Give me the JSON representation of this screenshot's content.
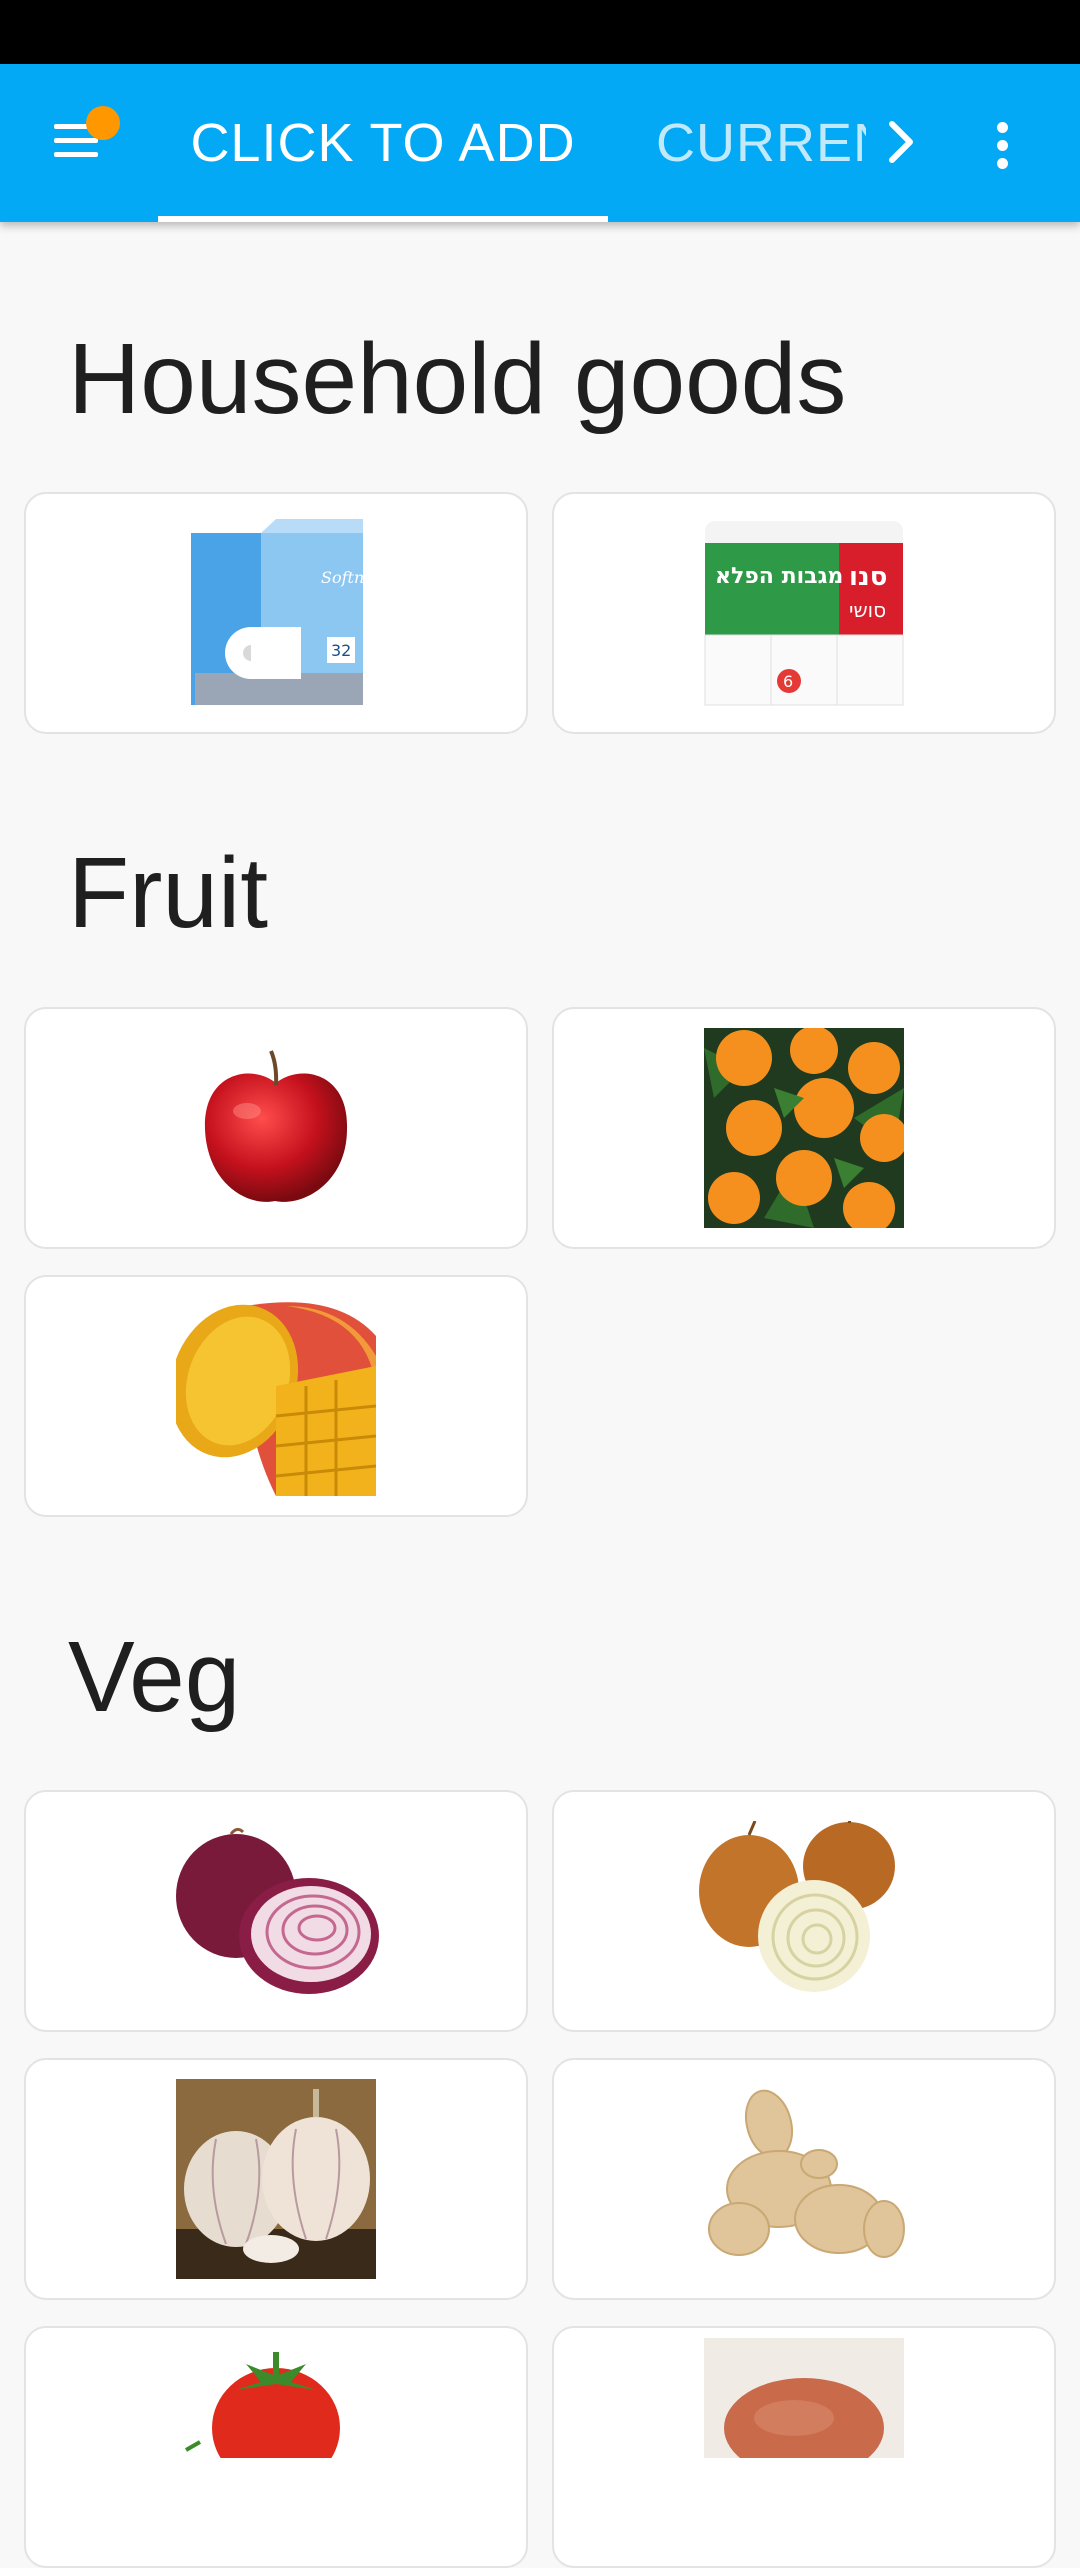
{
  "app_bar": {
    "tabs": [
      {
        "label": "CLICK TO ADD",
        "selected": true
      },
      {
        "label": "CURREN",
        "selected": false
      }
    ],
    "accent_color": "#03a9f4",
    "notification_dot_color": "#ff9800"
  },
  "sections": [
    {
      "title": "Household goods",
      "items": [
        "toilet-paper-pack",
        "paper-towel-pack"
      ]
    },
    {
      "title": "Fruit",
      "items": [
        "red-apple",
        "tangerines",
        "mango"
      ]
    },
    {
      "title": "Veg",
      "items": [
        "red-onion",
        "yellow-onions",
        "garlic",
        "ginger",
        "tomato",
        "sweet-potato"
      ]
    }
  ],
  "product_labels": {
    "toilet_paper_brand": "Softness",
    "toilet_paper_count": "32",
    "paper_towel_brand": "סנו",
    "paper_towel_subbrand": "סושי",
    "paper_towel_name": "מגבות הפלא",
    "paper_towel_count": "6"
  }
}
